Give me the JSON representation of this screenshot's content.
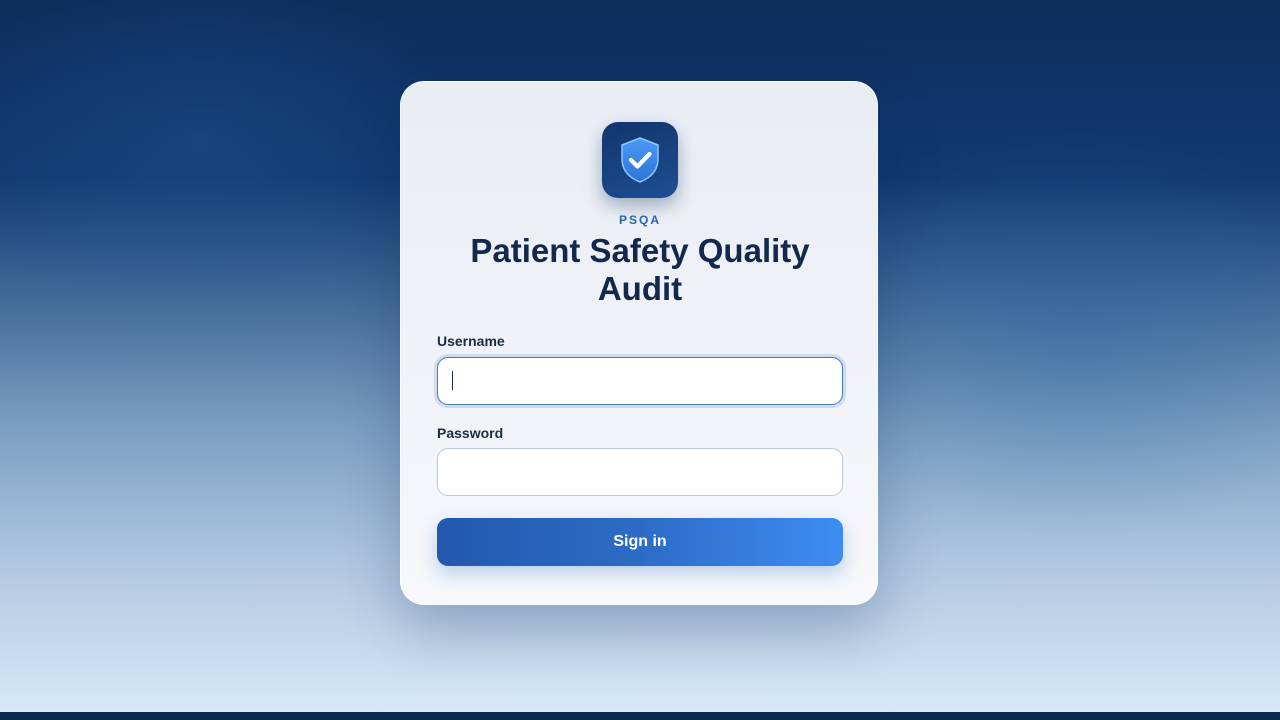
{
  "app": {
    "brand_short": "PSQA",
    "title": "Patient Safety Quality Audit",
    "logo_icon": "shield-check-icon"
  },
  "form": {
    "username_label": "Username",
    "username_value": "",
    "username_placeholder": "",
    "password_label": "Password",
    "password_value": "",
    "password_placeholder": "",
    "submit_label": "Sign in"
  },
  "colors": {
    "accent": "#2d6cc6",
    "button_gradient_start": "#2258ad",
    "button_gradient_end": "#3e8cf2",
    "title_text": "#13284a",
    "brand_text": "#2c63ad",
    "logo_tile": "#1a4585",
    "shield": "#3b8cf0"
  }
}
